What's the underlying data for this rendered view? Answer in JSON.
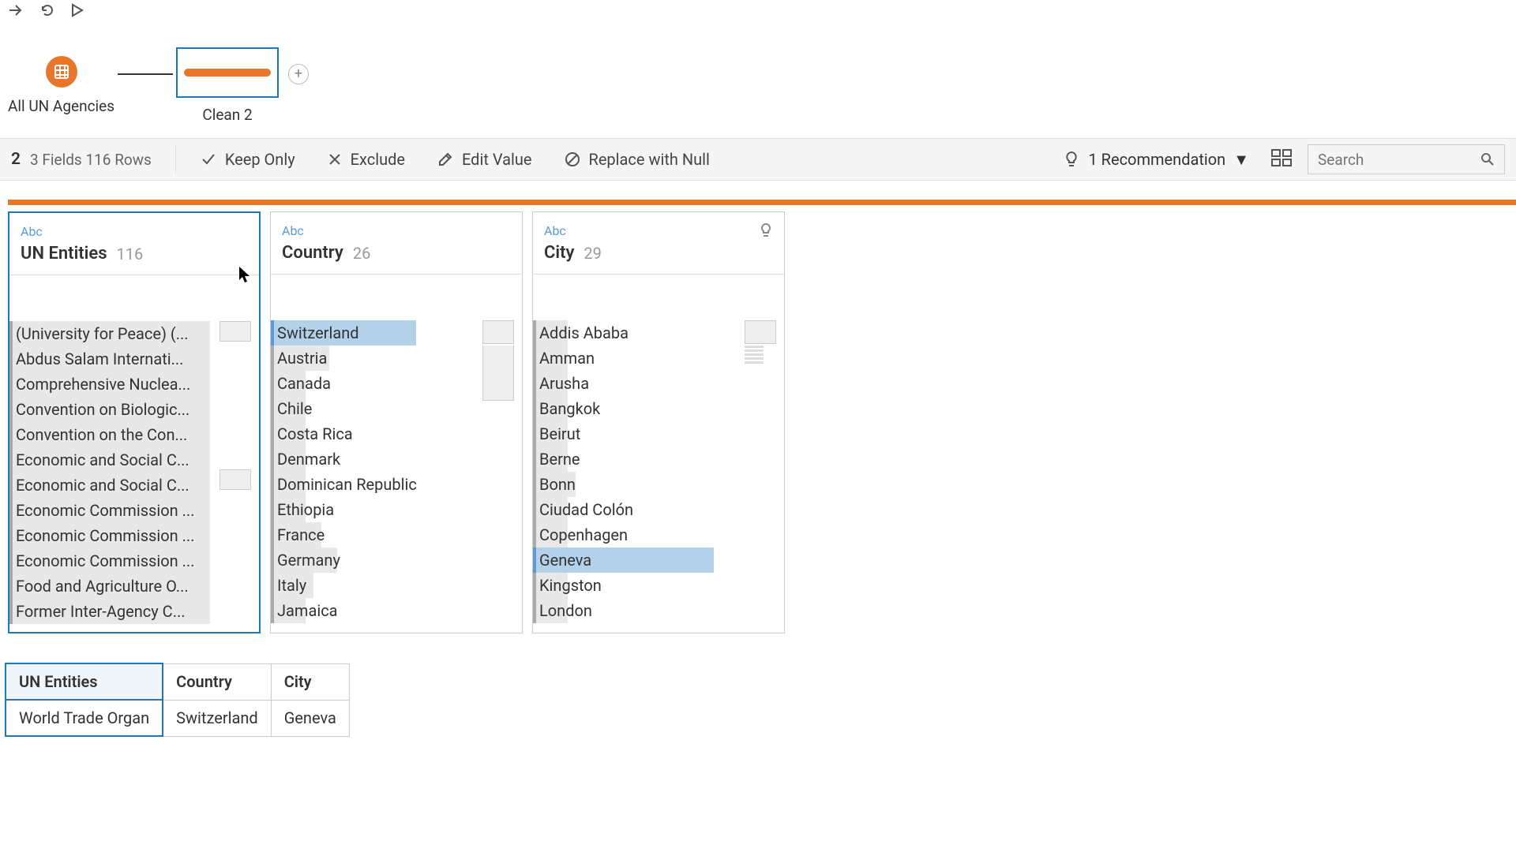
{
  "flow": {
    "source_label": "All UN Agencies",
    "clean_label": "Clean 2"
  },
  "toolbar": {
    "step_count": "2",
    "fields_rows": "3 Fields  116 Rows",
    "keep_only": "Keep Only",
    "exclude": "Exclude",
    "edit_value": "Edit Value",
    "replace_null": "Replace with Null",
    "recommendation": "1 Recommendation",
    "search_placeholder": "Search"
  },
  "cards": [
    {
      "type": "Abc",
      "title": "UN Entities",
      "count": "116",
      "values": [
        {
          "label": "(University for Peace) (...",
          "bar": 250
        },
        {
          "label": "Abdus Salam Internati...",
          "bar": 250
        },
        {
          "label": "Comprehensive Nuclea...",
          "bar": 250
        },
        {
          "label": "Convention on Biologic...",
          "bar": 250
        },
        {
          "label": "Convention on the Con...",
          "bar": 250
        },
        {
          "label": "Economic and Social C...",
          "bar": 250
        },
        {
          "label": "Economic and Social C...",
          "bar": 250
        },
        {
          "label": "Economic Commission ...",
          "bar": 250
        },
        {
          "label": "Economic Commission ...",
          "bar": 250
        },
        {
          "label": "Economic Commission ...",
          "bar": 250
        },
        {
          "label": "Food and Agriculture O...",
          "bar": 250
        },
        {
          "label": "Former Inter-Agency C...",
          "bar": 250
        }
      ]
    },
    {
      "type": "Abc",
      "title": "Country",
      "count": "26",
      "values": [
        {
          "label": "Switzerland",
          "bar": 180,
          "hl": true
        },
        {
          "label": "Austria",
          "bar": 70
        },
        {
          "label": "Canada",
          "bar": 40
        },
        {
          "label": "Chile",
          "bar": 40
        },
        {
          "label": "Costa Rica",
          "bar": 40
        },
        {
          "label": "Denmark",
          "bar": 40
        },
        {
          "label": "Dominican Republic",
          "bar": 40
        },
        {
          "label": "Ethiopia",
          "bar": 40
        },
        {
          "label": "France",
          "bar": 60
        },
        {
          "label": "Germany",
          "bar": 80
        },
        {
          "label": "Italy",
          "bar": 50
        },
        {
          "label": "Jamaica",
          "bar": 40
        }
      ]
    },
    {
      "type": "Abc",
      "title": "City",
      "count": "29",
      "bulb": true,
      "values": [
        {
          "label": "Addis Ababa",
          "bar": 40
        },
        {
          "label": "Amman",
          "bar": 40
        },
        {
          "label": "Arusha",
          "bar": 40
        },
        {
          "label": "Bangkok",
          "bar": 40
        },
        {
          "label": "Beirut",
          "bar": 40
        },
        {
          "label": "Berne",
          "bar": 40
        },
        {
          "label": "Bonn",
          "bar": 50
        },
        {
          "label": "Ciudad Colón",
          "bar": 40
        },
        {
          "label": "Copenhagen",
          "bar": 40
        },
        {
          "label": "Geneva",
          "bar": 225,
          "hl": true
        },
        {
          "label": "Kingston",
          "bar": 40
        },
        {
          "label": "London",
          "bar": 40
        }
      ]
    }
  ],
  "grid": {
    "headers": [
      "UN Entities",
      "Country",
      "City"
    ],
    "row": [
      "World Trade Organ",
      "Switzerland",
      "Geneva"
    ]
  }
}
